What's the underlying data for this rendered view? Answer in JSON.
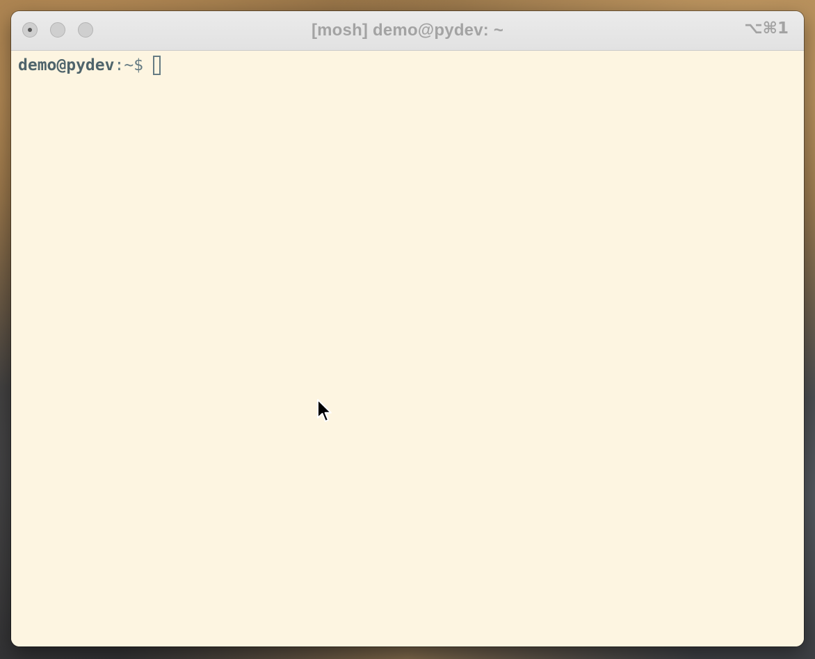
{
  "window": {
    "title": "[mosh] demo@pydev: ~",
    "shortcut": "⌥⌘1"
  },
  "terminal": {
    "prompt_user_host": "demo@pydev",
    "prompt_path": ":~$",
    "input": ""
  },
  "colors": {
    "terminal_background": "#fdf5e1",
    "prompt_text": "#586e75",
    "titlebar": "#e6e6e6",
    "title_text": "#a3a3a3"
  },
  "icons": {
    "pointer": "mouse-pointer-icon"
  }
}
